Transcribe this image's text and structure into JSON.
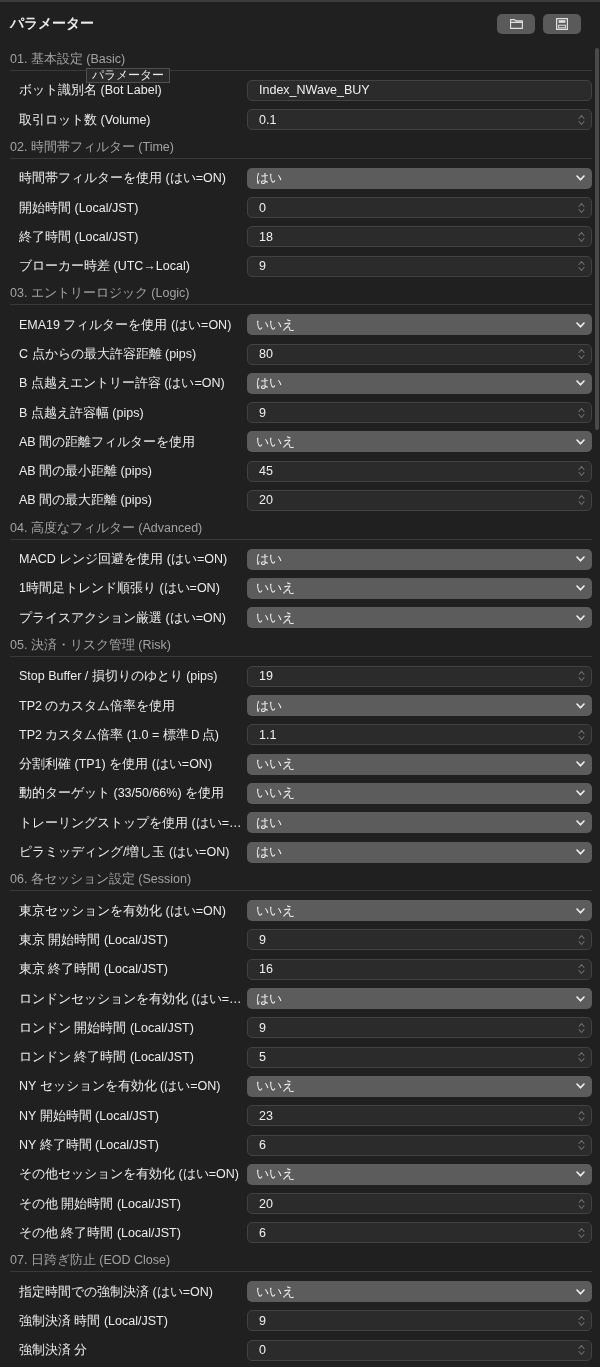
{
  "panel": {
    "title": "パラメーター",
    "tooltip": "パラメーター"
  },
  "sections": [
    {
      "title": "01. 基本設定 (Basic)",
      "fields": [
        {
          "label": "ボット識別名 (Bot Label)",
          "kind": "text",
          "value": "Index_NWave_BUY"
        },
        {
          "label": "取引ロット数 (Volume)",
          "kind": "number",
          "value": "0.1"
        }
      ]
    },
    {
      "title": "02. 時間帯フィルター (Time)",
      "fields": [
        {
          "label": "時間帯フィルターを使用 (はい=ON)",
          "kind": "select",
          "value": "はい"
        },
        {
          "label": "開始時間 (Local/JST)",
          "kind": "number",
          "value": "0"
        },
        {
          "label": "終了時間 (Local/JST)",
          "kind": "number",
          "value": "18"
        },
        {
          "label": "ブローカー時差 (UTC→Local)",
          "kind": "number",
          "value": "9"
        }
      ]
    },
    {
      "title": "03. エントリーロジック (Logic)",
      "fields": [
        {
          "label": "EMA19 フィルターを使用 (はい=ON)",
          "kind": "select",
          "value": "いいえ"
        },
        {
          "label": "C 点からの最大許容距離 (pips)",
          "kind": "number",
          "value": "80"
        },
        {
          "label": "B 点越えエントリー許容 (はい=ON)",
          "kind": "select",
          "value": "はい"
        },
        {
          "label": "B 点越え許容幅 (pips)",
          "kind": "number",
          "value": "9"
        },
        {
          "label": "AB 間の距離フィルターを使用",
          "kind": "select",
          "value": "いいえ"
        },
        {
          "label": "AB 間の最小距離 (pips)",
          "kind": "number",
          "value": "45"
        },
        {
          "label": "AB 間の最大距離 (pips)",
          "kind": "number",
          "value": "20"
        }
      ]
    },
    {
      "title": "04. 高度なフィルター (Advanced)",
      "fields": [
        {
          "label": "MACD レンジ回避を使用 (はい=ON)",
          "kind": "select",
          "value": "はい"
        },
        {
          "label": "1時間足トレンド順張り (はい=ON)",
          "kind": "select",
          "value": "いいえ"
        },
        {
          "label": "プライスアクション厳選 (はい=ON)",
          "kind": "select",
          "value": "いいえ"
        }
      ]
    },
    {
      "title": "05. 決済・リスク管理 (Risk)",
      "fields": [
        {
          "label": "Stop Buffer / 損切りのゆとり (pips)",
          "kind": "number",
          "value": "19"
        },
        {
          "label": "TP2 のカスタム倍率を使用",
          "kind": "select",
          "value": "はい"
        },
        {
          "label": "TP2 カスタム倍率 (1.0 = 標準Ｄ点)",
          "kind": "number",
          "value": "1.1"
        },
        {
          "label": "分割利確 (TP1) を使用 (はい=ON)",
          "kind": "select",
          "value": "いいえ"
        },
        {
          "label": "動的ターゲット (33/50/66%) を使用",
          "kind": "select",
          "value": "いいえ"
        },
        {
          "label": "トレーリングストップを使用 (はい=…",
          "kind": "select",
          "value": "はい"
        },
        {
          "label": "ピラミッディング/増し玉 (はい=ON)",
          "kind": "select",
          "value": "はい"
        }
      ]
    },
    {
      "title": "06. 各セッション設定 (Session)",
      "fields": [
        {
          "label": "東京セッションを有効化 (はい=ON)",
          "kind": "select",
          "value": "いいえ"
        },
        {
          "label": "東京 開始時間 (Local/JST)",
          "kind": "number",
          "value": "9"
        },
        {
          "label": "東京 終了時間 (Local/JST)",
          "kind": "number",
          "value": "16"
        },
        {
          "label": "ロンドンセッションを有効化 (はい=…",
          "kind": "select",
          "value": "はい"
        },
        {
          "label": "ロンドン 開始時間 (Local/JST)",
          "kind": "number",
          "value": "9"
        },
        {
          "label": "ロンドン 終了時間 (Local/JST)",
          "kind": "number",
          "value": "5"
        },
        {
          "label": "NY セッションを有効化 (はい=ON)",
          "kind": "select",
          "value": "いいえ"
        },
        {
          "label": "NY 開始時間 (Local/JST)",
          "kind": "number",
          "value": "23"
        },
        {
          "label": "NY 終了時間 (Local/JST)",
          "kind": "number",
          "value": "6"
        },
        {
          "label": "その他セッションを有効化 (はい=ON)",
          "kind": "select",
          "value": "いいえ"
        },
        {
          "label": "その他 開始時間 (Local/JST)",
          "kind": "number",
          "value": "20"
        },
        {
          "label": "その他 終了時間 (Local/JST)",
          "kind": "number",
          "value": "6"
        }
      ]
    },
    {
      "title": "07. 日跨ぎ防止 (EOD Close)",
      "fields": [
        {
          "label": "指定時間での強制決済 (はい=ON)",
          "kind": "select",
          "value": "いいえ"
        },
        {
          "label": "強制決済 時間 (Local/JST)",
          "kind": "number",
          "value": "9"
        },
        {
          "label": "強制決済 分",
          "kind": "number",
          "value": "0"
        }
      ]
    }
  ]
}
